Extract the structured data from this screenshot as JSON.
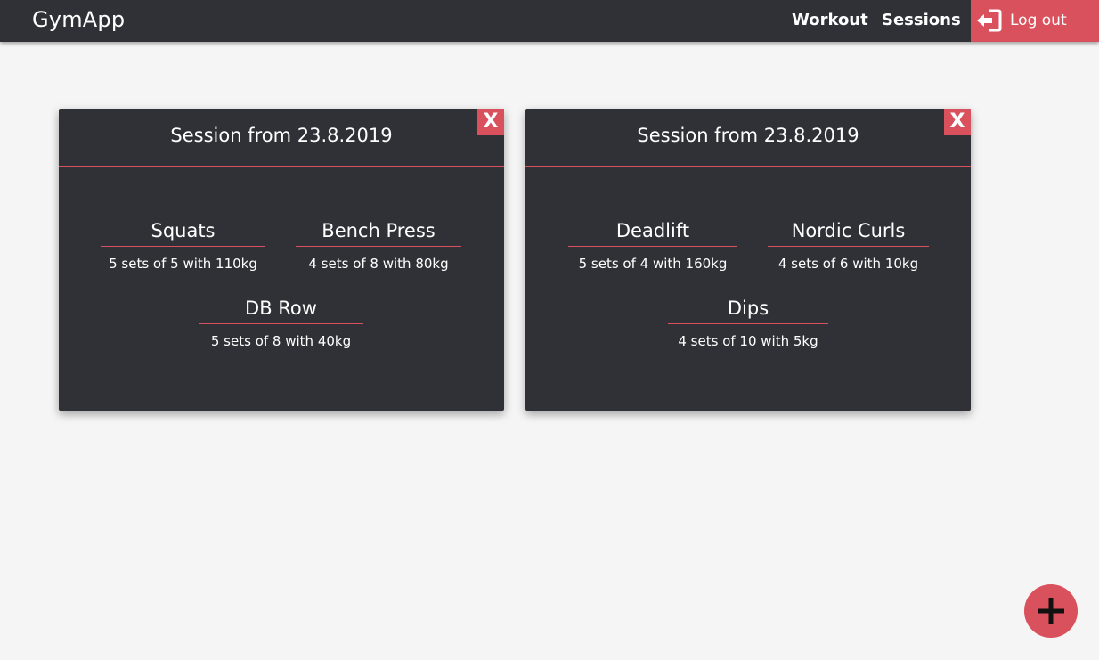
{
  "app": {
    "brand": "GymApp"
  },
  "nav": {
    "workout": "Workout",
    "sessions": "Sessions",
    "logout": "Log out",
    "logout_icon": "sign-out-icon"
  },
  "colors": {
    "navbar": "#2f3136",
    "accent": "#d9515c",
    "background": "#f5f5f5"
  },
  "sessions": [
    {
      "title": "Session from 23.8.2019",
      "close_label": "X",
      "exercises": [
        {
          "name": "Squats",
          "detail": "5 sets of 5 with 110kg"
        },
        {
          "name": "Bench Press",
          "detail": "4 sets of 8 with 80kg"
        },
        {
          "name": "DB Row",
          "detail": "5 sets of 8 with 40kg"
        }
      ]
    },
    {
      "title": "Session from 23.8.2019",
      "close_label": "X",
      "exercises": [
        {
          "name": "Deadlift",
          "detail": "5 sets of 4 with 160kg"
        },
        {
          "name": "Nordic Curls",
          "detail": "4 sets of 6 with 10kg"
        },
        {
          "name": "Dips",
          "detail": "4 sets of 10 with 5kg"
        }
      ]
    }
  ],
  "fab": {
    "icon": "plus-icon"
  }
}
